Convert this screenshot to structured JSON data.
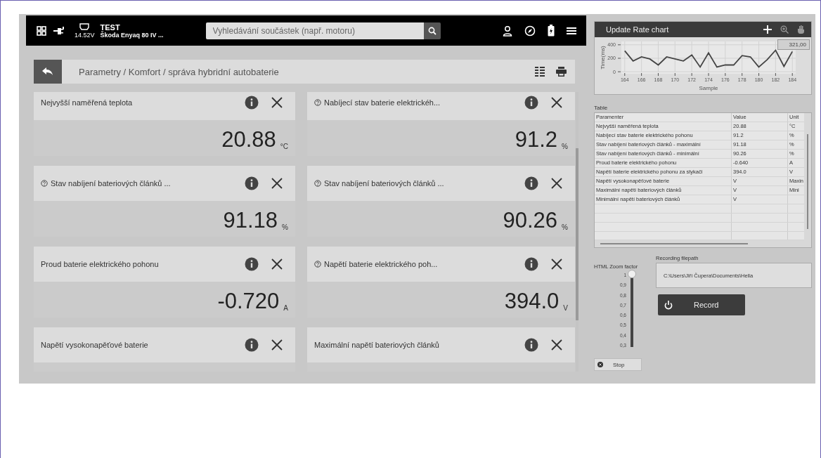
{
  "header": {
    "voltage": "14.52V",
    "title": "TEST",
    "vehicle": "Škoda Enyaq 80 IV ...",
    "search": {
      "placeholder": "Vyhledávání součástek (např. motoru)"
    }
  },
  "breadcrumb": "Parametry / Komfort / správa hybridní autobaterie",
  "cards": [
    {
      "title": "Nejvyšší naměřená teplota",
      "help": false,
      "value": "20.88",
      "unit": "°C"
    },
    {
      "title": "Nabíjecí stav baterie elektrickéh...",
      "help": true,
      "value": "91.2",
      "unit": "%"
    },
    {
      "title": "Stav nabíjení bateriových článků ...",
      "help": true,
      "value": "91.18",
      "unit": "%"
    },
    {
      "title": "Stav nabíjení bateriových článků ...",
      "help": true,
      "value": "90.26",
      "unit": "%"
    },
    {
      "title": "Proud baterie elektrického pohonu",
      "help": false,
      "value": "-0.720",
      "unit": "A"
    },
    {
      "title": "Napětí baterie elektrického poh...",
      "help": true,
      "value": "394.0",
      "unit": "V"
    },
    {
      "title": "Napětí vysokonapěťové baterie",
      "help": false
    },
    {
      "title": "Maximální napětí bateriových článků",
      "help": false
    }
  ],
  "chart": {
    "title": "Update Rate chart",
    "tooltip": "321,00",
    "chart_data": {
      "type": "line",
      "xlabel": "Sample",
      "ylabel": "Time(ms)",
      "x": [
        164,
        165,
        166,
        167,
        168,
        169,
        170,
        171,
        172,
        173,
        174,
        175,
        176,
        177,
        178,
        179,
        180,
        181,
        182,
        183,
        184
      ],
      "series": [
        {
          "color": "#444444",
          "values": [
            310,
            160,
            220,
            190,
            100,
            220,
            190,
            160,
            250,
            70,
            280,
            70,
            100,
            100,
            240,
            220,
            70,
            180,
            320,
            80,
            300
          ]
        }
      ],
      "xlim": [
        163.6,
        184.4
      ],
      "ylim": [
        -30,
        450
      ],
      "grid": true,
      "xticks": [
        164,
        166,
        168,
        170,
        172,
        174,
        176,
        178,
        180,
        182,
        184
      ],
      "yticks": [
        0,
        200,
        400
      ]
    }
  },
  "table": {
    "label": "Table",
    "columns": [
      "Paramenter",
      "Value",
      "Unit"
    ],
    "rows": [
      [
        "Nejvyšší naměřená teplota",
        "20.88",
        "°C"
      ],
      [
        "Nabíjecí stav baterie elektrického pohonu",
        "91.2",
        "%"
      ],
      [
        "Stav nabíjení bateriových článků - maximální",
        "91.18",
        "%"
      ],
      [
        "Stav nabíjení bateriových článků - minimální",
        "90.26",
        "%"
      ],
      [
        "Proud baterie elektrického pohonu",
        "-0.640",
        "A"
      ],
      [
        "Napětí baterie elektrického pohonu za stykači",
        "394.0",
        "V"
      ],
      [
        "Napětí vysokonapěťové baterie",
        "V",
        "Maxin"
      ],
      [
        "Maximální napětí bateriových článků",
        "V",
        "Mini"
      ],
      [
        "Minimální napětí bateriových článků",
        "V",
        ""
      ]
    ]
  },
  "zoom": {
    "label": "HTML Zoom factor",
    "level": 1,
    "ticks": [
      "1",
      "0,9",
      "0,8",
      "0,7",
      "0,6",
      "0,5",
      "0,4",
      "0,3"
    ]
  },
  "recording": {
    "label": "Recording filepath",
    "value": "C:\\Users\\Jiří Čupera\\Documents\\Hella",
    "record": "Record",
    "stop": "Stop"
  }
}
